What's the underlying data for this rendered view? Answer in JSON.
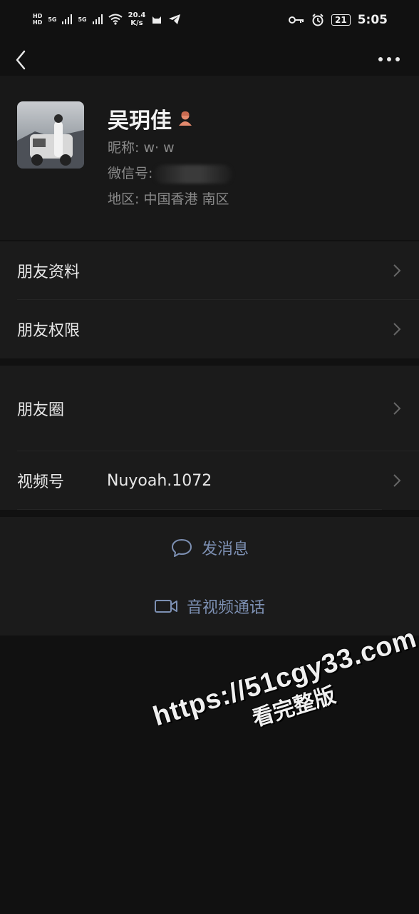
{
  "status_bar": {
    "hd_top": "HD",
    "hd_bottom": "HD",
    "sim1": "5G",
    "sim2": "5G",
    "net_speed_value": "20.4",
    "net_speed_unit": "K/s",
    "battery": "21",
    "time": "5:05"
  },
  "profile": {
    "name": "吴玥佳",
    "nickname_label": "昵称:",
    "nickname_value": "w· w",
    "wechat_id_label": "微信号:",
    "region_label": "地区:",
    "region_value": "中国香港  南区"
  },
  "menu_group_1": [
    {
      "label": "朋友资料"
    },
    {
      "label": "朋友权限"
    }
  ],
  "menu_group_2": [
    {
      "label": "朋友圈"
    },
    {
      "label": "视频号",
      "value": "Nuyoah.1072"
    }
  ],
  "actions": {
    "message": "发消息",
    "call": "音视频通话"
  },
  "watermark": {
    "url": "https://51cgy33.com",
    "sub": "看完整版"
  },
  "colors": {
    "background": "#111111",
    "panel": "#1b1b1b",
    "action_text": "#7d90b3",
    "secondary_text": "#8a8a8a"
  }
}
